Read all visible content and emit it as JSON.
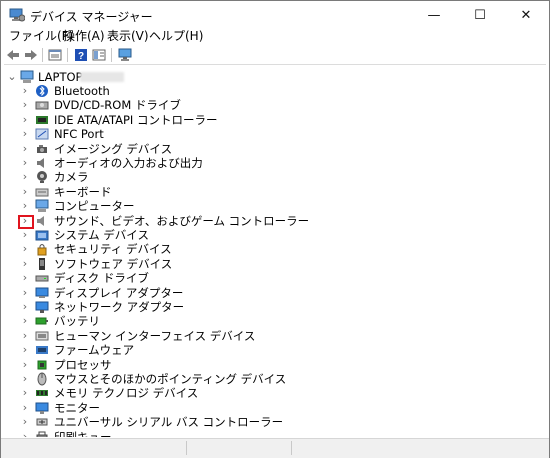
{
  "window": {
    "title": "デバイス マネージャー",
    "minimize": "—",
    "maximize": "☐",
    "close": "✕"
  },
  "menu": [
    {
      "label": "ファイル(F)"
    },
    {
      "label": "操作(A)"
    },
    {
      "label": "表示(V)"
    },
    {
      "label": "ヘルプ(H)"
    }
  ],
  "toolbar": [
    "back-icon",
    "forward-icon",
    "properties-icon",
    "help-icon",
    "show-hide-icon",
    "monitor-icon"
  ],
  "tree": {
    "root": "LAPTOP-",
    "items": [
      {
        "label": "Bluetooth",
        "icon": "bluetooth-icon"
      },
      {
        "label": "DVD/CD-ROM ドライブ",
        "icon": "dvd-drive-icon"
      },
      {
        "label": "IDE ATA/ATAPI コントローラー",
        "icon": "ide-controller-icon"
      },
      {
        "label": "NFC Port",
        "icon": "nfc-icon"
      },
      {
        "label": "イメージング デバイス",
        "icon": "imaging-icon"
      },
      {
        "label": "オーディオの入力および出力",
        "icon": "audio-icon"
      },
      {
        "label": "カメラ",
        "icon": "camera-icon"
      },
      {
        "label": "キーボード",
        "icon": "keyboard-icon"
      },
      {
        "label": "コンピューター",
        "icon": "computer-icon"
      },
      {
        "label": "サウンド、ビデオ、およびゲーム コントローラー",
        "icon": "sound-icon"
      },
      {
        "label": "システム デバイス",
        "icon": "system-devices-icon"
      },
      {
        "label": "セキュリティ デバイス",
        "icon": "security-icon"
      },
      {
        "label": "ソフトウェア デバイス",
        "icon": "software-device-icon"
      },
      {
        "label": "ディスク ドライブ",
        "icon": "disk-drive-icon"
      },
      {
        "label": "ディスプレイ アダプター",
        "icon": "display-adapter-icon"
      },
      {
        "label": "ネットワーク アダプター",
        "icon": "network-adapter-icon"
      },
      {
        "label": "バッテリ",
        "icon": "battery-icon"
      },
      {
        "label": "ヒューマン インターフェイス デバイス",
        "icon": "hid-icon"
      },
      {
        "label": "ファームウェア",
        "icon": "firmware-icon"
      },
      {
        "label": "プロセッサ",
        "icon": "processor-icon"
      },
      {
        "label": "マウスとそのほかのポインティング デバイス",
        "icon": "mouse-icon"
      },
      {
        "label": "メモリ テクノロジ デバイス",
        "icon": "memory-icon"
      },
      {
        "label": "モニター",
        "icon": "monitor-icon"
      },
      {
        "label": "ユニバーサル シリアル バス コントローラー",
        "icon": "usb-icon"
      },
      {
        "label": "印刷キュー",
        "icon": "print-queue-icon"
      }
    ]
  }
}
